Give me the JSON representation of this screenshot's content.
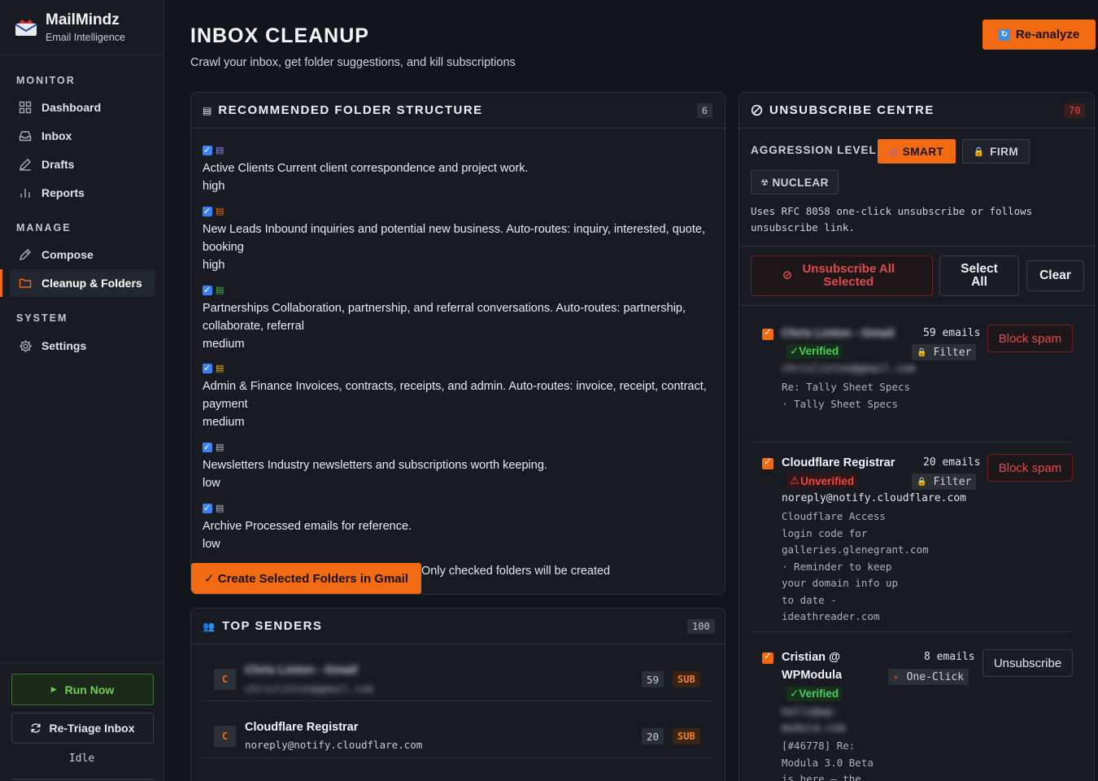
{
  "brand": {
    "name": "MailMindz",
    "tagline": "Email Intelligence"
  },
  "nav": {
    "sections": [
      "MONITOR",
      "MANAGE",
      "SYSTEM"
    ],
    "items": [
      {
        "label": "Dashboard",
        "icon": "grid-icon"
      },
      {
        "label": "Inbox",
        "icon": "inbox-icon"
      },
      {
        "label": "Drafts",
        "icon": "pencil-icon"
      },
      {
        "label": "Reports",
        "icon": "bar-chart-icon"
      },
      {
        "label": "Compose",
        "icon": "edit-icon"
      },
      {
        "label": "Cleanup & Folders",
        "icon": "folder-icon",
        "active": true
      },
      {
        "label": "Settings",
        "icon": "gear-icon"
      }
    ]
  },
  "sidebar_footer": {
    "run_now": "Run Now",
    "retriage": "Re-Triage Inbox",
    "status": "Idle"
  },
  "header": {
    "title": "INBOX CLEANUP",
    "subtitle": "Crawl your inbox, get folder suggestions, and kill subscriptions",
    "reanalyze": "Re-analyze"
  },
  "folders_panel": {
    "title": "RECOMMENDED FOLDER STRUCTURE",
    "count": "6",
    "folders": [
      {
        "text": "Active Clients Current client correspondence and project work.",
        "priority": "high",
        "icon_color": "#8b8ff0"
      },
      {
        "text": "New Leads Inbound inquiries and potential new business. Auto-routes: inquiry, interested, quote, booking",
        "priority": "high",
        "icon_color": "#f06a16"
      },
      {
        "text": "Partnerships Collaboration, partnership, and referral conversations. Auto-routes: partnership, collaborate, referral",
        "priority": "medium",
        "icon_color": "#4bbf5a"
      },
      {
        "text": "Admin & Finance Invoices, contracts, receipts, and admin. Auto-routes: invoice, receipt, contract, payment",
        "priority": "medium",
        "icon_color": "#e8b32a"
      },
      {
        "text": "Newsletters Industry newsletters and subscriptions worth keeping.",
        "priority": "low",
        "icon_color": "#b9bdc6"
      },
      {
        "text": "Archive Processed emails for reference.",
        "priority": "low",
        "icon_color": "#b9bdc6"
      }
    ],
    "create_button": "✓ Create Selected Folders in Gmail",
    "create_note": "Only checked folders will be created"
  },
  "senders_panel": {
    "title": "TOP SENDERS",
    "count": "100",
    "senders": [
      {
        "initial": "C",
        "name": "Chris Linton - Gmail",
        "email": "chrislinton@gmail.com",
        "count": "59",
        "badge": "SUB"
      },
      {
        "initial": "C",
        "name": "Cloudflare Registrar",
        "email": "noreply@notify.cloudflare.com",
        "count": "20",
        "badge": "SUB"
      }
    ]
  },
  "unsub_panel": {
    "title": "UNSUBSCRIBE CENTRE",
    "count": "70",
    "aggression_label": "AGGRESSION LEVEL:",
    "levels": {
      "smart": "SMART",
      "firm": "FIRM",
      "nuclear": "NUCLEAR"
    },
    "description": "Uses RFC 8058 one-click unsubscribe or follows unsubscribe link.",
    "unsub_all": "Unsubscribe All Selected",
    "select_all": "Select All",
    "clear": "Clear",
    "senders": [
      {
        "name": "Chris Linton - Gmail",
        "status": "✓Verified",
        "email": "chrislinton@gmail.com",
        "subject": "Re: Tally Sheet Specs · Tally Sheet Specs",
        "count": "59 emails",
        "method": "Filter",
        "action": "Block spam"
      },
      {
        "name": "Cloudflare Registrar",
        "status": "Unverified",
        "email": "noreply@notify.cloudflare.com",
        "subject": "Cloudflare Access login code for galleries.glenegrant.com · Reminder to keep your domain info up to date - ideathreader.com",
        "count": "20 emails",
        "method": "Filter",
        "action": "Block spam"
      },
      {
        "name": "Cristian @ WPModula",
        "status": "✓Verified",
        "email": "hello@wp-modula.com",
        "subject": "[#46778] Re: Modula 3.0 Beta is here — the",
        "count": "8 emails",
        "method": "One-Click",
        "action": "Unsubscribe"
      }
    ]
  }
}
